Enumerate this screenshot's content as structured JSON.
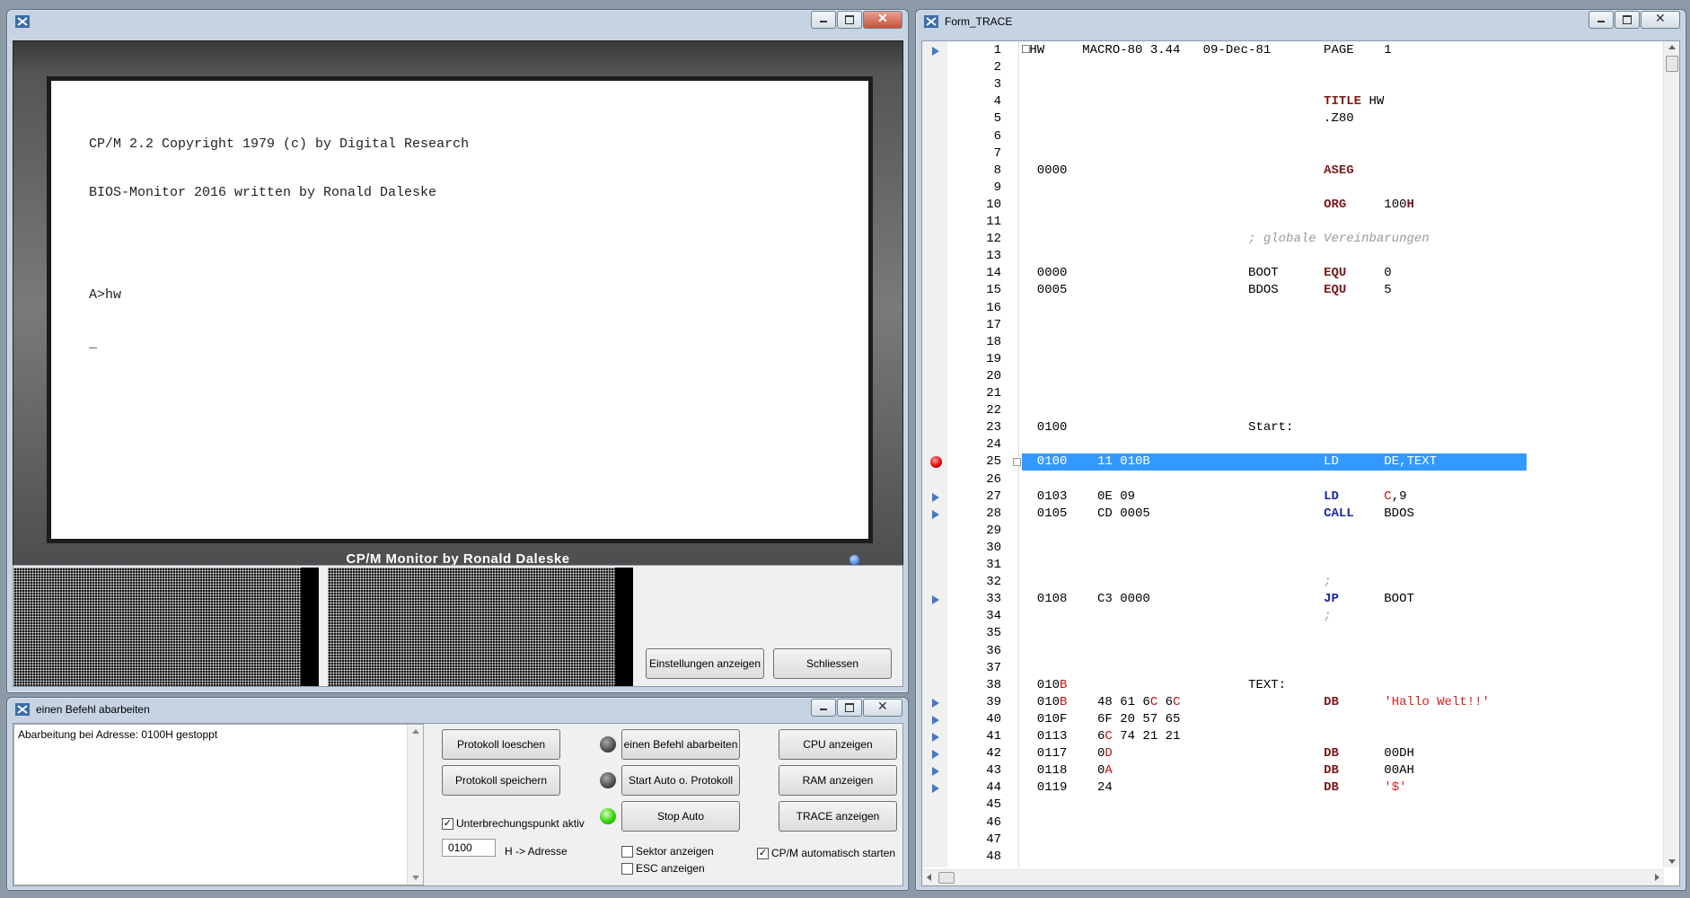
{
  "cpm_window": {
    "title": "",
    "screen_lines": [
      "CP/M 2.2 Copyright 1979 (c) by Digital Research",
      "BIOS-Monitor 2016 written by Ronald Daleske",
      "",
      "A>hw",
      "_"
    ],
    "caption": "CP/M Monitor by Ronald Daleske",
    "btn_settings": "Einstellungen anzeigen",
    "btn_close": "Schliessen"
  },
  "trace_window": {
    "title": "Form_TRACE",
    "rows": [
      {
        "n": "1",
        "mark": "arrow",
        "code": [
          {
            "t": "□HW     MACRO-80 3.44   09-Dec-81       PAGE    1"
          }
        ]
      },
      {
        "n": "2",
        "code": []
      },
      {
        "n": "3",
        "code": []
      },
      {
        "n": "4",
        "code": [
          {
            "t": "                                        "
          },
          {
            "t": "TITLE",
            "c": "kw"
          },
          {
            "t": " HW"
          }
        ]
      },
      {
        "n": "5",
        "code": [
          {
            "t": "                                        .Z80"
          }
        ]
      },
      {
        "n": "6",
        "code": []
      },
      {
        "n": "7",
        "code": []
      },
      {
        "n": "8",
        "code": [
          {
            "t": "  0000                                  "
          },
          {
            "t": "ASEG",
            "c": "kw"
          }
        ]
      },
      {
        "n": "9",
        "code": []
      },
      {
        "n": "10",
        "code": [
          {
            "t": "                                        "
          },
          {
            "t": "ORG",
            "c": "kw"
          },
          {
            "t": "     100"
          },
          {
            "t": "H",
            "c": "kw"
          }
        ]
      },
      {
        "n": "11",
        "code": []
      },
      {
        "n": "12",
        "code": [
          {
            "t": "                              "
          },
          {
            "t": "; globale Vereinbarungen",
            "c": "cmt"
          }
        ]
      },
      {
        "n": "13",
        "code": []
      },
      {
        "n": "14",
        "code": [
          {
            "t": "  0000                        BOOT      "
          },
          {
            "t": "EQU",
            "c": "kw"
          },
          {
            "t": "     0"
          }
        ]
      },
      {
        "n": "15",
        "code": [
          {
            "t": "  0005                        BDOS      "
          },
          {
            "t": "EQU",
            "c": "kw"
          },
          {
            "t": "     5"
          }
        ]
      },
      {
        "n": "16",
        "code": []
      },
      {
        "n": "17",
        "code": []
      },
      {
        "n": "18",
        "code": []
      },
      {
        "n": "19",
        "code": []
      },
      {
        "n": "20",
        "code": []
      },
      {
        "n": "21",
        "code": []
      },
      {
        "n": "22",
        "code": []
      },
      {
        "n": "23",
        "code": [
          {
            "t": "  0100                        Start:"
          }
        ]
      },
      {
        "n": "24",
        "code": []
      },
      {
        "n": "25",
        "mark": "bp",
        "hl": true,
        "code": [
          {
            "t": "  0100    11 010B                       LD      DE,TEXT"
          }
        ]
      },
      {
        "n": "26",
        "code": []
      },
      {
        "n": "27",
        "mark": "arrow",
        "code": [
          {
            "t": "  0103    0E 09                         "
          },
          {
            "t": "LD",
            "c": "kwb"
          },
          {
            "t": "      "
          },
          {
            "t": "C",
            "c": "kwr"
          },
          {
            "t": ",9"
          }
        ]
      },
      {
        "n": "28",
        "mark": "arrow",
        "code": [
          {
            "t": "  0105    CD 0005                       "
          },
          {
            "t": "CALL",
            "c": "kwb"
          },
          {
            "t": "    BDOS"
          }
        ]
      },
      {
        "n": "29",
        "code": []
      },
      {
        "n": "30",
        "code": []
      },
      {
        "n": "31",
        "code": []
      },
      {
        "n": "32",
        "code": [
          {
            "t": "                                        "
          },
          {
            "t": ";",
            "c": "cmt"
          }
        ]
      },
      {
        "n": "33",
        "mark": "arrow",
        "code": [
          {
            "t": "  0108    C3 0000                       "
          },
          {
            "t": "JP",
            "c": "kwb"
          },
          {
            "t": "      BOOT"
          }
        ]
      },
      {
        "n": "34",
        "code": [
          {
            "t": "                                        "
          },
          {
            "t": ";",
            "c": "cmt"
          }
        ]
      },
      {
        "n": "35",
        "code": []
      },
      {
        "n": "36",
        "code": []
      },
      {
        "n": "37",
        "code": []
      },
      {
        "n": "38",
        "code": [
          {
            "t": "  010"
          },
          {
            "t": "B",
            "c": "kwr"
          },
          {
            "t": "                        TEXT:"
          }
        ]
      },
      {
        "n": "39",
        "mark": "arrow",
        "code": [
          {
            "t": "  010"
          },
          {
            "t": "B",
            "c": "kwr"
          },
          {
            "t": "    48 61 6"
          },
          {
            "t": "C",
            "c": "kwr"
          },
          {
            "t": " 6"
          },
          {
            "t": "C",
            "c": "kwr"
          },
          {
            "t": "                   "
          },
          {
            "t": "DB",
            "c": "kw"
          },
          {
            "t": "      "
          },
          {
            "t": "'Hallo Welt!!'",
            "c": "str"
          }
        ]
      },
      {
        "n": "40",
        "mark": "arrow",
        "code": [
          {
            "t": "  010F    6F 20 57 65"
          }
        ]
      },
      {
        "n": "41",
        "mark": "arrow",
        "code": [
          {
            "t": "  0113    6"
          },
          {
            "t": "C",
            "c": "kwr"
          },
          {
            "t": " 74 21 21"
          }
        ]
      },
      {
        "n": "42",
        "mark": "arrow",
        "code": [
          {
            "t": "  0117    0"
          },
          {
            "t": "D",
            "c": "kwr"
          },
          {
            "t": "                            "
          },
          {
            "t": "DB",
            "c": "kw"
          },
          {
            "t": "      00DH"
          }
        ]
      },
      {
        "n": "43",
        "mark": "arrow",
        "code": [
          {
            "t": "  0118    0"
          },
          {
            "t": "A",
            "c": "kwr"
          },
          {
            "t": "                            "
          },
          {
            "t": "DB",
            "c": "kw"
          },
          {
            "t": "      00AH"
          }
        ]
      },
      {
        "n": "44",
        "mark": "arrow",
        "code": [
          {
            "t": "  0119    24                            "
          },
          {
            "t": "DB",
            "c": "kw"
          },
          {
            "t": "      "
          },
          {
            "t": "'$'",
            "c": "str"
          }
        ]
      },
      {
        "n": "45",
        "code": []
      },
      {
        "n": "46",
        "code": []
      },
      {
        "n": "47",
        "code": []
      },
      {
        "n": "48",
        "code": []
      }
    ]
  },
  "step_window": {
    "title": "einen Befehl abarbeiten",
    "log_text": "Abarbeitung bei Adresse: 0100H gestoppt",
    "btn_clear_log": "Protokoll loeschen",
    "btn_save_log": "Protokoll speichern",
    "btn_step": "einen Befehl abarbeiten",
    "btn_start_auto": "Start Auto o. Protokoll",
    "btn_stop_auto": "Stop Auto",
    "btn_cpu": "CPU anzeigen",
    "btn_ram": "RAM anzeigen",
    "btn_trace": "TRACE anzeigen",
    "chk_breakpoint": "Unterbrechungspunkt aktiv",
    "address_value": "0100",
    "address_label": "H -> Adresse",
    "chk_sector": "Sektor anzeigen",
    "chk_esc": "ESC anzeigen",
    "chk_autostart": "CP/M automatisch starten",
    "check_mark": "✓"
  }
}
